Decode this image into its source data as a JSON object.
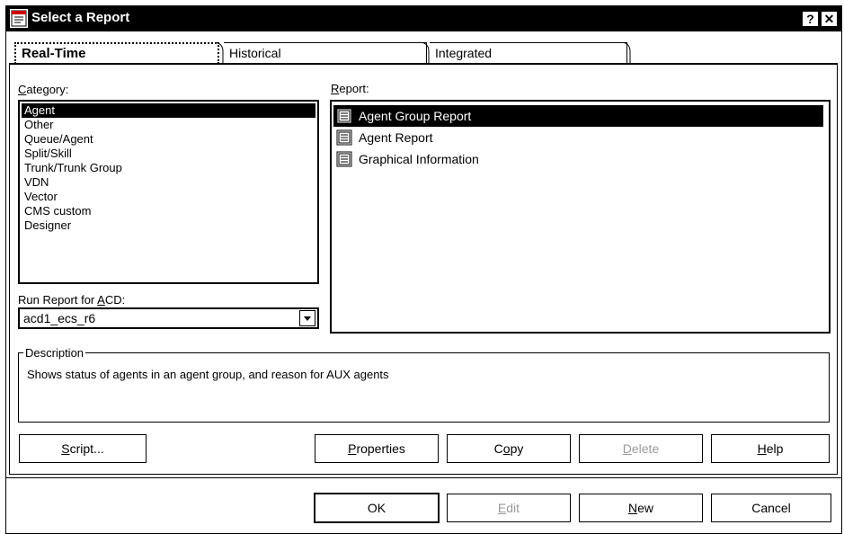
{
  "window": {
    "title": "Select a Report",
    "help_button": "?",
    "close_button": "✕"
  },
  "tabs": [
    {
      "label": "Real-Time",
      "active": true
    },
    {
      "label": "Historical",
      "active": false
    },
    {
      "label": "Integrated",
      "active": false
    }
  ],
  "category": {
    "label_underlined": "C",
    "label_rest": "ategory:",
    "items": [
      "Agent",
      "Other",
      "Queue/Agent",
      "Split/Skill",
      "Trunk/Trunk Group",
      "VDN",
      "Vector",
      "CMS custom",
      "Designer"
    ],
    "selected": "Agent"
  },
  "report": {
    "label_underlined": "R",
    "label_rest": "eport:",
    "items": [
      "Agent Group Report",
      "Agent Report",
      "Graphical Information"
    ],
    "selected": "Agent Group Report",
    "icon": "report-document-icon"
  },
  "acd": {
    "label_prefix": "Run Report for ",
    "label_underlined": "A",
    "label_rest": "CD:",
    "value": "acd1_ecs_r6"
  },
  "description": {
    "legend": "Description",
    "text": "Shows status of agents in an agent group, and reason for AUX agents"
  },
  "buttons_row1": {
    "script": {
      "u": "S",
      "rest": "cript..."
    },
    "properties": {
      "u": "P",
      "rest": "roperties"
    },
    "copy": {
      "pre": "C",
      "u": "o",
      "rest": "py"
    },
    "delete": {
      "u": "D",
      "rest": "elete",
      "disabled": true
    },
    "help": {
      "u": "H",
      "rest": "elp"
    }
  },
  "buttons_row2": {
    "ok": "OK",
    "edit": {
      "u": "E",
      "rest": "dit",
      "disabled": true
    },
    "new": {
      "u": "N",
      "rest": "ew"
    },
    "cancel": "Cancel"
  },
  "colors": {
    "selection": "#000000",
    "disabled_text": "#9a9a9a",
    "background": "#ffffff"
  }
}
